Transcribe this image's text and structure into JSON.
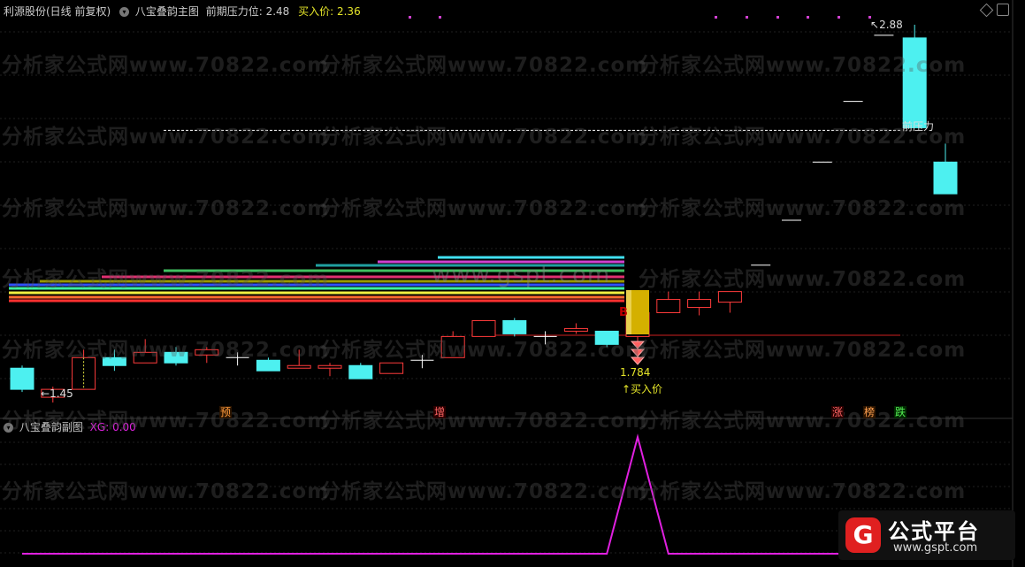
{
  "header": {
    "stock": "利源股份(日线 前复权)",
    "indicator_name": "八宝叠韵主图",
    "resistance_label": "前期压力位:",
    "resistance_value": "2.48",
    "buy_label": "买入价:",
    "buy_value": "2.36"
  },
  "sub_header": {
    "indicator_name": "八宝叠韵副图",
    "xg_label": "XG:",
    "xg_value": "0.00"
  },
  "annotations": {
    "low_price": "1.45",
    "high_price": "2.88",
    "front_resistance": "前压力",
    "buy_marker": "B",
    "buy_price_value": "1.784",
    "buy_price_label": "↑买入价",
    "tag_pre": "预",
    "tag_increase": "增",
    "tag_rise": "涨",
    "tag_hot": "榜",
    "tag_fall": "跌"
  },
  "watermarks": {
    "site": "分析家公式网www.70822.com",
    "gspt": "www.gspt.com"
  },
  "logo": {
    "title": "公式平台",
    "url": "www.gspt.com"
  },
  "colors": {
    "up": "#ff3b3b",
    "down": "#4df0f0",
    "resistance_label": "#dddd44",
    "sub_line": "#e020e0",
    "buy_bar": "#d4b000"
  },
  "candles": [
    {
      "o": 1.58,
      "c": 1.5,
      "h": 1.59,
      "l": 1.49
    },
    {
      "o": 1.47,
      "c": 1.5,
      "h": 1.51,
      "l": 1.45
    },
    {
      "o": 1.5,
      "c": 1.62,
      "h": 1.65,
      "l": 1.5
    },
    {
      "o": 1.62,
      "c": 1.59,
      "h": 1.65,
      "l": 1.57
    },
    {
      "o": 1.6,
      "c": 1.64,
      "h": 1.69,
      "l": 1.6
    },
    {
      "o": 1.64,
      "c": 1.6,
      "h": 1.66,
      "l": 1.59
    },
    {
      "o": 1.63,
      "c": 1.65,
      "h": 1.66,
      "l": 1.6
    },
    {
      "o": 1.62,
      "c": 1.62,
      "h": 1.64,
      "l": 1.59
    },
    {
      "o": 1.61,
      "c": 1.57,
      "h": 1.62,
      "l": 1.57
    },
    {
      "o": 1.58,
      "c": 1.59,
      "h": 1.65,
      "l": 1.58
    },
    {
      "o": 1.58,
      "c": 1.59,
      "h": 1.6,
      "l": 1.55
    },
    {
      "o": 1.59,
      "c": 1.54,
      "h": 1.6,
      "l": 1.54
    },
    {
      "o": 1.56,
      "c": 1.6,
      "h": 1.6,
      "l": 1.56
    },
    {
      "o": 1.61,
      "c": 1.61,
      "h": 1.63,
      "l": 1.58
    },
    {
      "o": 1.62,
      "c": 1.7,
      "h": 1.72,
      "l": 1.62
    },
    {
      "o": 1.7,
      "c": 1.76,
      "h": 1.76,
      "l": 1.7
    },
    {
      "o": 1.76,
      "c": 1.71,
      "h": 1.77,
      "l": 1.7
    },
    {
      "o": 1.7,
      "c": 1.7,
      "h": 1.72,
      "l": 1.67
    },
    {
      "o": 1.72,
      "c": 1.73,
      "h": 1.75,
      "l": 1.71
    },
    {
      "o": 1.72,
      "c": 1.67,
      "h": 1.72,
      "l": 1.66
    },
    {
      "o": 1.7,
      "c": 1.79,
      "h": 1.79,
      "l": 1.68
    },
    {
      "o": 1.79,
      "c": 1.84,
      "h": 1.87,
      "l": 1.79
    },
    {
      "o": 1.81,
      "c": 1.84,
      "h": 1.87,
      "l": 1.78
    },
    {
      "o": 1.83,
      "c": 1.87,
      "h": 1.87,
      "l": 1.79
    },
    {
      "o": 1.97,
      "c": 1.97,
      "h": 1.97,
      "l": 1.97
    },
    {
      "o": 2.14,
      "c": 2.14,
      "h": 2.14,
      "l": 2.14
    },
    {
      "o": 2.36,
      "c": 2.36,
      "h": 2.36,
      "l": 2.36
    },
    {
      "o": 2.59,
      "c": 2.59,
      "h": 2.59,
      "l": 2.59
    },
    {
      "o": 2.84,
      "c": 2.84,
      "h": 2.84,
      "l": 2.84
    },
    {
      "o": 2.83,
      "c": 2.49,
      "h": 2.88,
      "l": 2.49
    },
    {
      "o": 2.36,
      "c": 2.24,
      "h": 2.43,
      "l": 2.24
    }
  ],
  "sub_series": [
    0,
    0,
    0,
    0,
    0,
    0,
    0,
    0,
    0,
    0,
    0,
    0,
    0,
    0,
    0,
    0,
    0,
    0,
    0,
    0,
    1,
    0,
    0,
    0,
    0,
    0,
    0,
    0,
    0,
    0,
    0
  ]
}
